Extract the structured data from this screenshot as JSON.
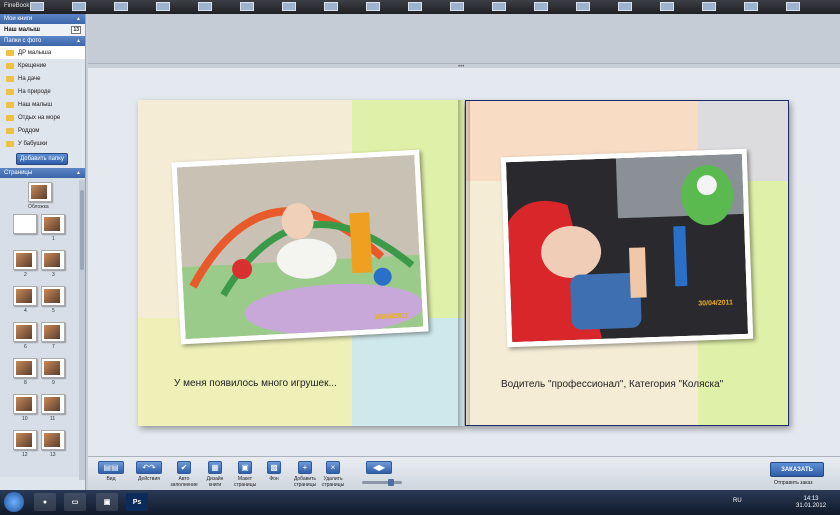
{
  "app": {
    "title": "FineBook"
  },
  "sidebar": {
    "my_books_header": "Мои книги",
    "book": {
      "name": "Наш малыш",
      "badge": "13"
    },
    "photo_folders_header": "Папки с фото",
    "folders": [
      "ДР малыша",
      "Крещение",
      "На даче",
      "На природе",
      "Наш малыш",
      "Отдых на море",
      "Роддом",
      "У бабушки"
    ],
    "add_folder_label": "Добавить папку",
    "pages_header": "Страницы",
    "cover_label": "Обложка",
    "page_labels": [
      "1",
      "2",
      "3",
      "4",
      "5",
      "6",
      "7",
      "8",
      "9",
      "10",
      "11",
      "12",
      "13"
    ]
  },
  "spread": {
    "left_caption": "У меня появилось много игрушек...",
    "left_date": "18/04/2011",
    "right_caption": "Водитель \"профессионал\", Категория \"Коляска\"",
    "right_date": "30/04/2011"
  },
  "toolbar": {
    "view": "Вид",
    "actions": "Действия",
    "autofill": "Авто заполнение",
    "book_design": "Дизайн книги",
    "page_layout": "Макет страницы",
    "background": "Фон",
    "add_pages": "Добавить страницы",
    "delete_pages": "Удалить страницы",
    "order_label": "ЗАКАЗАТЬ",
    "send_order": "Отправить заказ"
  },
  "taskbar": {
    "lang": "RU",
    "time": "14:13",
    "date": "31.01.2012"
  },
  "colors": {
    "accent": "#3b66a8",
    "page_cream": "#f5ecd5",
    "page_green": "#dff0a8",
    "page_yellow": "#eef0b8",
    "page_blue": "#cfe8ec",
    "page_peach": "#f8dcc4",
    "page_grey": "#dcdcde"
  }
}
